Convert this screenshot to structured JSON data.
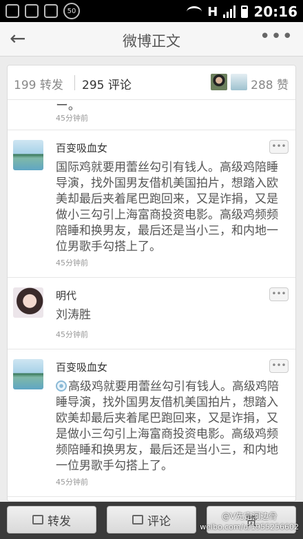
{
  "statusbar": {
    "battery_badge": "50",
    "network": "H",
    "time": "20:16"
  },
  "titlebar": {
    "title": "微博正文"
  },
  "tabs": {
    "reposts": "199 转发",
    "comments": "295 评论",
    "likes": "288 赞"
  },
  "partial_comment": {
    "time": "45分钟前"
  },
  "comments": [
    {
      "name": "百变吸血女",
      "text": "国际鸡就要用蕾丝勾引有钱人。高级鸡陪睡导演，找外国男友借机美国拍片，想踏入欧美却最后夹着尾巴跑回来，又是诈捐，又是做小三勾引上海富商投资电影。高级鸡频频陪睡和换男友，最后还是当小三，和内地一位男歌手勾搭上了。",
      "time": "45分钟前"
    },
    {
      "name": "明代",
      "text": "刘涛胜",
      "time": "45分钟前"
    },
    {
      "name": "百变吸血女",
      "text": "高级鸡就要用蕾丝勾引有钱人。高级鸡陪睡导演，找外国男友借机美国拍片，想踏入欧美却最后夹着尾巴跑回来，又是诈捐，又是做小三勾引上海富商投资电影。高级鸡频频陪睡和换男友，最后还是当小三，和内地一位男歌手勾搭上了。",
      "time": "45分钟前"
    }
  ],
  "bottombar": {
    "repost": "转发",
    "comment": "评论",
    "like": "赞"
  },
  "watermark": {
    "logo": "@V先定河边骨",
    "url": "weibo.com/u/1955256602"
  },
  "icons": [
    "back-arrow-icon",
    "more-icon",
    "wifi-icon",
    "signal-icon",
    "battery-icon",
    "options-icon",
    "repost-icon",
    "comment-icon"
  ]
}
